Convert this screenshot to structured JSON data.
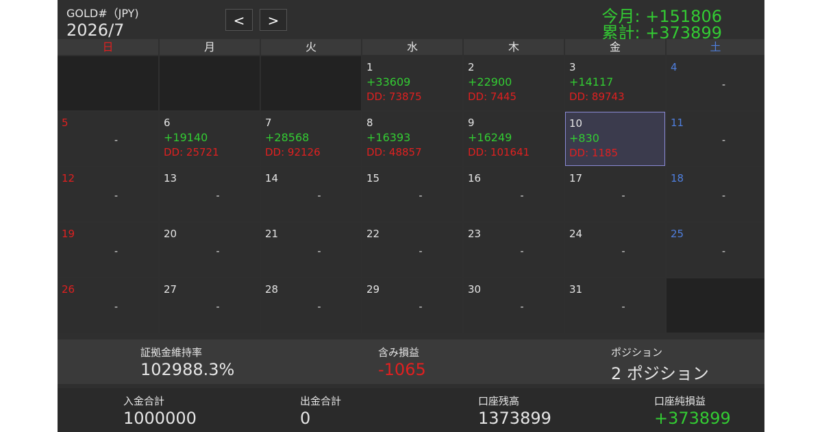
{
  "header": {
    "symbol": "GOLD#（JPY)",
    "year_month": "2026/7",
    "prev_label": "<",
    "next_label": ">",
    "month_pl": "今月: +151806",
    "total_pl": "累計: +373899"
  },
  "weekdays": [
    "日",
    "月",
    "火",
    "水",
    "木",
    "金",
    "土"
  ],
  "weeks": [
    [
      {
        "empty": true
      },
      {
        "empty": true
      },
      {
        "empty": true
      },
      {
        "day": "1",
        "pl": "+33609",
        "dd": "DD: 73875"
      },
      {
        "day": "2",
        "pl": "+22900",
        "dd": "DD: 7445"
      },
      {
        "day": "3",
        "pl": "+14117",
        "dd": "DD: 89743"
      },
      {
        "day": "4",
        "dash": "-"
      }
    ],
    [
      {
        "day": "5",
        "dash": "-"
      },
      {
        "day": "6",
        "pl": "+19140",
        "dd": "DD: 25721"
      },
      {
        "day": "7",
        "pl": "+28568",
        "dd": "DD: 92126"
      },
      {
        "day": "8",
        "pl": "+16393",
        "dd": "DD: 48857"
      },
      {
        "day": "9",
        "pl": "+16249",
        "dd": "DD: 101641"
      },
      {
        "day": "10",
        "pl": "+830",
        "dd": "DD: 1185",
        "today": true
      },
      {
        "day": "11",
        "dash": "-"
      }
    ],
    [
      {
        "day": "12",
        "dash": "-"
      },
      {
        "day": "13",
        "dash": "-"
      },
      {
        "day": "14",
        "dash": "-"
      },
      {
        "day": "15",
        "dash": "-"
      },
      {
        "day": "16",
        "dash": "-"
      },
      {
        "day": "17",
        "dash": "-"
      },
      {
        "day": "18",
        "dash": "-"
      }
    ],
    [
      {
        "day": "19",
        "dash": "-"
      },
      {
        "day": "20",
        "dash": "-"
      },
      {
        "day": "21",
        "dash": "-"
      },
      {
        "day": "22",
        "dash": "-"
      },
      {
        "day": "23",
        "dash": "-"
      },
      {
        "day": "24",
        "dash": "-"
      },
      {
        "day": "25",
        "dash": "-"
      }
    ],
    [
      {
        "day": "26",
        "dash": "-"
      },
      {
        "day": "27",
        "dash": "-"
      },
      {
        "day": "28",
        "dash": "-"
      },
      {
        "day": "29",
        "dash": "-"
      },
      {
        "day": "30",
        "dash": "-"
      },
      {
        "day": "31",
        "dash": "-"
      },
      {
        "empty": true
      }
    ]
  ],
  "summary": {
    "margin_label": "証拠金維持率",
    "margin_value": "102988.3%",
    "unrealized_label": "含み損益",
    "unrealized_value": "-1065",
    "positions_label": "ポジション",
    "positions_value": "2 ポジション",
    "deposit_label": "入金合計",
    "deposit_value": "1000000",
    "withdraw_label": "出金合計",
    "withdraw_value": "0",
    "balance_label": "口座残高",
    "balance_value": "1373899",
    "net_label": "口座純損益",
    "net_value": "+373899"
  },
  "colors": {
    "positive": "#33cc33",
    "negative": "#e02020",
    "saturday": "#4f7fdf",
    "background": "#2f2f2f"
  }
}
